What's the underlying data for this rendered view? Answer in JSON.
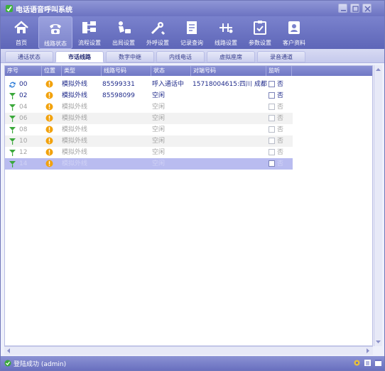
{
  "window": {
    "title": "电话语音呼叫系统"
  },
  "toolbar": {
    "items": [
      {
        "label": "首页",
        "icon": "home-icon"
      },
      {
        "label": "线路状态",
        "icon": "phone-icon",
        "active": true
      },
      {
        "label": "流程设置",
        "icon": "flow-icon"
      },
      {
        "label": "出局设置",
        "icon": "outbound-icon"
      },
      {
        "label": "外呼设置",
        "icon": "tools-icon"
      },
      {
        "label": "记录查询",
        "icon": "record-icon"
      },
      {
        "label": "线路设置",
        "icon": "line-icon"
      },
      {
        "label": "参数设置",
        "icon": "param-icon"
      },
      {
        "label": "客户资料",
        "icon": "user-icon"
      }
    ]
  },
  "tabs": [
    {
      "label": "通话状态"
    },
    {
      "label": "市话线路",
      "active": true
    },
    {
      "label": "数字中继"
    },
    {
      "label": "内线电话"
    },
    {
      "label": "虚拟座席"
    },
    {
      "label": "录音通道"
    }
  ],
  "grid": {
    "columns": [
      "序号",
      "位置",
      "类型",
      "线路号码",
      "状态",
      "对端号码",
      "监听"
    ],
    "rows": [
      {
        "id": "00",
        "type": "模拟外线",
        "number": "85599331",
        "status": "呼入通话中",
        "peer": "15718004615:四川 成都",
        "monitor": "否",
        "state": "active",
        "icon": "refresh-icon"
      },
      {
        "id": "02",
        "type": "模拟外线",
        "number": "85598099",
        "status": "空闲",
        "peer": "",
        "monitor": "否",
        "state": "active",
        "icon": "signal-icon"
      },
      {
        "id": "04",
        "type": "模拟外线",
        "number": "",
        "status": "空闲",
        "peer": "",
        "monitor": "否",
        "state": "dim",
        "icon": "signal-icon"
      },
      {
        "id": "06",
        "type": "模拟外线",
        "number": "",
        "status": "空闲",
        "peer": "",
        "monitor": "否",
        "state": "dim",
        "icon": "signal-icon"
      },
      {
        "id": "08",
        "type": "模拟外线",
        "number": "",
        "status": "空闲",
        "peer": "",
        "monitor": "否",
        "state": "dim",
        "icon": "signal-icon"
      },
      {
        "id": "10",
        "type": "模拟外线",
        "number": "",
        "status": "空闲",
        "peer": "",
        "monitor": "否",
        "state": "dim",
        "icon": "signal-icon"
      },
      {
        "id": "12",
        "type": "模拟外线",
        "number": "",
        "status": "空闲",
        "peer": "",
        "monitor": "否",
        "state": "dim",
        "icon": "signal-icon"
      },
      {
        "id": "14",
        "type": "模拟外线",
        "number": "",
        "status": "空闲",
        "peer": "",
        "monitor": "否",
        "state": "selected",
        "icon": "signal-icon"
      }
    ]
  },
  "status": {
    "text": "登陆成功 (admin)"
  },
  "colors": {
    "accent": "#6c73c2",
    "active_text": "#1f2a8a",
    "warning": "#f2a20c",
    "signal": "#3aa83a"
  }
}
